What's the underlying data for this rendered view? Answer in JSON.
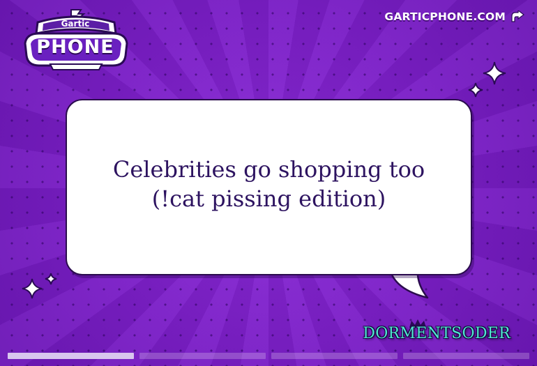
{
  "logo": {
    "top_text": "Gartic",
    "main_text": "PHONE"
  },
  "header": {
    "site_link": "GARTICPHONE.COM",
    "site_link_icon": "external-arrow-icon"
  },
  "prompt": {
    "line1": "Celebrities go shopping too",
    "line2": "(!cat pissing edition)"
  },
  "author": {
    "name": "DORMENTSODER",
    "badge_icon": "crown-icon"
  },
  "progress": {
    "segments": 4,
    "active_index": 0
  },
  "colors": {
    "background": "#7c1fc9",
    "bubble": "#ffffff",
    "prompt_text": "#2d1360",
    "author_text": "#4fe8cf",
    "progress_active": "#d8c6ee"
  }
}
